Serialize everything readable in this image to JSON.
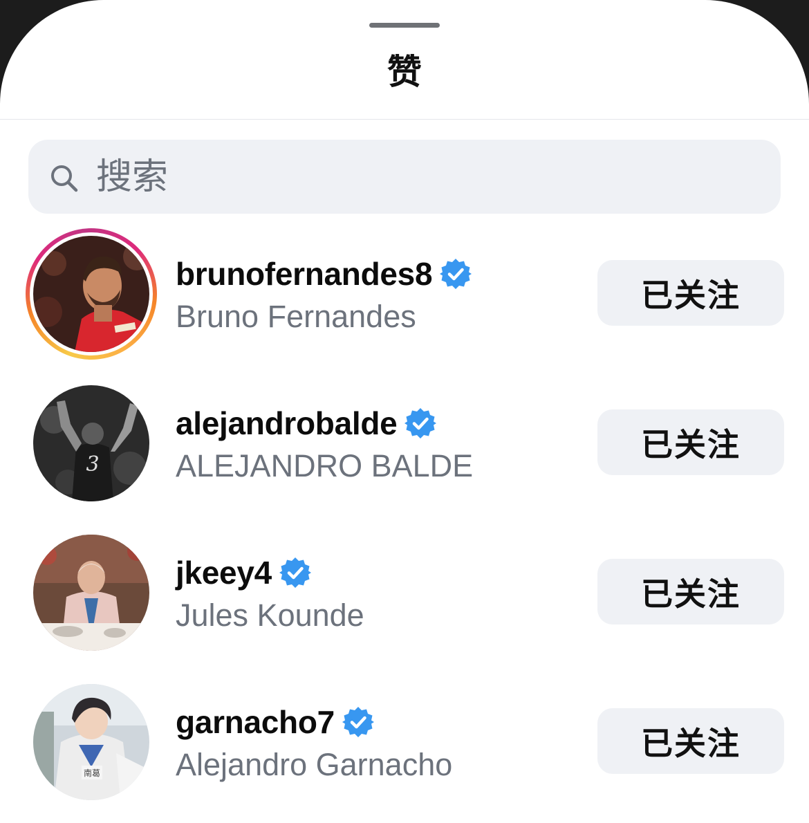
{
  "sheet": {
    "title": "赞"
  },
  "search": {
    "placeholder": "搜索",
    "icon": "search-icon"
  },
  "colors": {
    "verified_badge": "#3897f0",
    "button_bg": "#eff1f5",
    "secondary_text": "#6c727c"
  },
  "likes": [
    {
      "username": "brunofernandes8",
      "full_name": "Bruno Fernandes",
      "verified": true,
      "has_story": true,
      "button_label": "已关注"
    },
    {
      "username": "alejandrobalde",
      "full_name": "ALEJANDRO BALDE",
      "verified": true,
      "has_story": false,
      "button_label": "已关注"
    },
    {
      "username": "jkeey4",
      "full_name": "Jules Kounde",
      "verified": true,
      "has_story": false,
      "button_label": "已关注"
    },
    {
      "username": "garnacho7",
      "full_name": "Alejandro Garnacho",
      "verified": true,
      "has_story": false,
      "button_label": "已关注"
    }
  ]
}
